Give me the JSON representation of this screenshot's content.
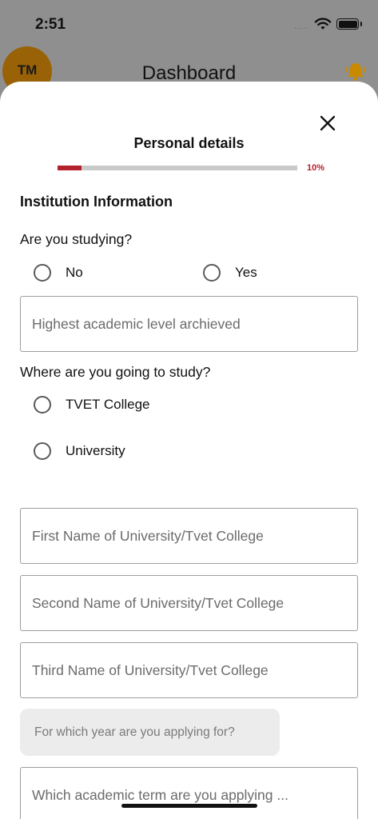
{
  "status_bar": {
    "time": "2:51",
    "dots": "····"
  },
  "background": {
    "avatar_initials": "TM",
    "title": "Dashboard"
  },
  "sheet": {
    "title": "Personal details",
    "progress": {
      "value": 0.1,
      "label": "10%"
    },
    "section_title": "Institution Information",
    "q_studying": {
      "question": "Are you studying?",
      "options": [
        "No",
        "Yes"
      ],
      "selected": null
    },
    "field_highest_level": {
      "placeholder": "Highest academic level archieved",
      "value": ""
    },
    "q_where_study": {
      "question": "Where are you going to study?",
      "options": [
        "TVET College",
        "University"
      ],
      "selected": null
    },
    "field_first_name": {
      "placeholder": "First Name of University/Tvet College",
      "value": ""
    },
    "field_second_name": {
      "placeholder": "Second Name of University/Tvet College",
      "value": ""
    },
    "field_third_name": {
      "placeholder": "Third Name of University/Tvet College",
      "value": ""
    },
    "select_year": {
      "placeholder": "For which year are you applying for?"
    },
    "field_term": {
      "placeholder": "Which academic term are you applying ...",
      "value": ""
    }
  },
  "colors": {
    "accent": "#b3212c",
    "avatar_bg": "#9a6206",
    "bell": "#c98a00",
    "progress_track": "#c9c9c9"
  },
  "icons": [
    "wifi-icon",
    "battery-icon",
    "bell-icon",
    "close-icon",
    "radio-icon"
  ]
}
